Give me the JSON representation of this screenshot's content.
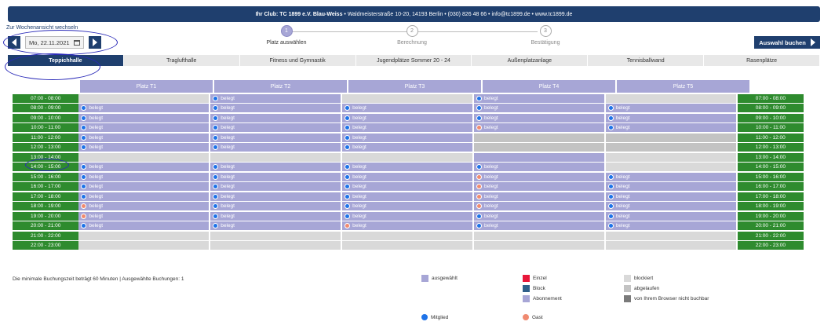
{
  "header": {
    "club": "Ihr Club: TC 1899 e.V. Blau-Weiss",
    "contact": "• Waldmeisterstraße 10-20, 14193 Berlin • (030) 826 48 66 • info@tc1899.de • www.tc1899.de"
  },
  "week_label": "Zur Wochenansicht wechseln",
  "date": "Mo, 22.11.2021",
  "steps": [
    {
      "num": "1",
      "label": "Platz auswählen"
    },
    {
      "num": "2",
      "label": "Berechnung"
    },
    {
      "num": "3",
      "label": "Bestätigung"
    }
  ],
  "book_button": "Auswahl buchen",
  "tabs": [
    "Teppichhalle",
    "Traglufthalle",
    "Fitness und Gymnastik",
    "Jugendplätze Sommer 20 - 24",
    "Außenplatzanlage",
    "Tennisballwand",
    "Rasenplätze"
  ],
  "courts": [
    "Platz T1",
    "Platz T2",
    "Platz T3",
    "Platz T4",
    "Platz T5"
  ],
  "times": [
    "07:00 - 08:00",
    "08:00 - 09:00",
    "09:00 - 10:00",
    "10:00 - 11:00",
    "11:00 - 12:00",
    "12:00 - 13:00",
    "13:00 - 14:00",
    "14:00 - 15:00",
    "15:00 - 16:00",
    "16:00 - 17:00",
    "17:00 - 18:00",
    "18:00 - 19:00",
    "19:00 - 20:00",
    "20:00 - 21:00",
    "21:00 - 22:00",
    "22:00 - 23:00"
  ],
  "booked_label": "belegt",
  "schedule": [
    [
      "e",
      "bb",
      "e",
      "bb",
      "e"
    ],
    [
      "bb",
      "bb",
      "bb",
      "bb",
      "bb"
    ],
    [
      "bb",
      "bb",
      "bb",
      "bb",
      "bb"
    ],
    [
      "bb",
      "bb",
      "bb",
      "bo",
      "bb"
    ],
    [
      "bb",
      "bb",
      "bb",
      "g",
      "g"
    ],
    [
      "bb",
      "bb",
      "bb",
      "g",
      "g"
    ],
    [
      "e",
      "e",
      "e",
      "b",
      "e"
    ],
    [
      "bb",
      "bb",
      "bb",
      "bb",
      "e"
    ],
    [
      "bb",
      "bb",
      "bb",
      "bo",
      "bb"
    ],
    [
      "bb",
      "bb",
      "bb",
      "bo",
      "bb"
    ],
    [
      "bb",
      "bb",
      "bb",
      "bo",
      "bb"
    ],
    [
      "bo",
      "bb",
      "bb",
      "bo",
      "bb"
    ],
    [
      "bo",
      "bb",
      "bb",
      "bb",
      "bb"
    ],
    [
      "bb",
      "bb",
      "bo",
      "bb",
      "bb"
    ],
    [
      "e",
      "e",
      "e",
      "e",
      "e"
    ],
    [
      "e",
      "e",
      "e",
      "e",
      "e"
    ]
  ],
  "footer_text": "Die minimale Buchungszeit beträgt 60 Minuten | Ausgewählte Buchungen: 1",
  "legend": {
    "selected": "ausgewählt",
    "single": "Einzel",
    "block": "Block",
    "subscription": "Abonnement",
    "blocked": "blockiert",
    "expired": "abgelaufen",
    "not_bookable": "von Ihrem Browser nicht buchbar",
    "member": "Mitglied",
    "guest": "Gast"
  },
  "colors": {
    "navy": "#1f3f6e",
    "green": "#2e8b2e",
    "booked": "#a7a6d6",
    "empty": "#d9d9d9",
    "grey": "#c3c3c3",
    "member": "#1e73e8",
    "guest": "#f08a70",
    "single": "#e8173a",
    "block": "#2f5f8a"
  }
}
